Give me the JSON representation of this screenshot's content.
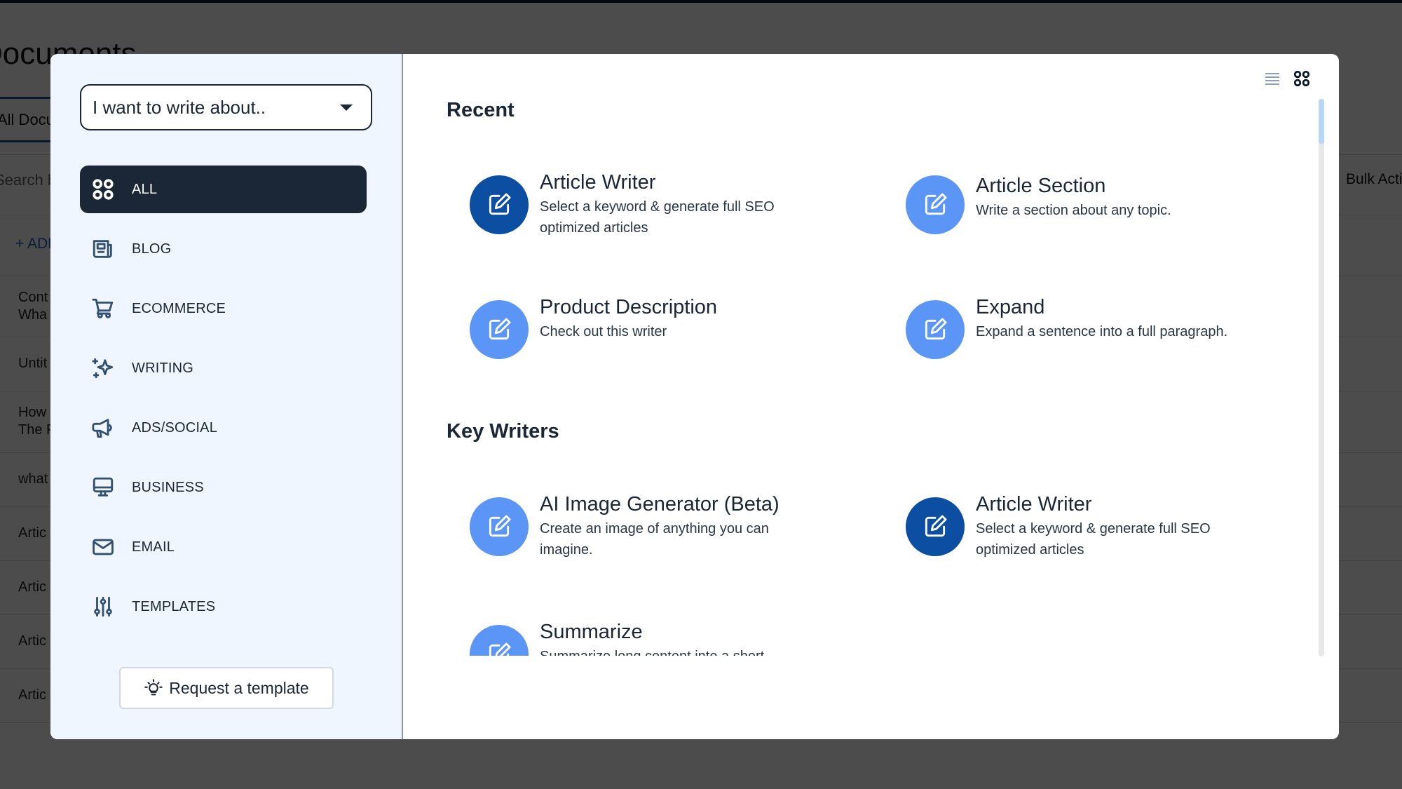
{
  "background": {
    "page_title": "Documents",
    "tab_label": "All Documents",
    "search_placeholder": "Search by",
    "bulk_actions_label": "Bulk Actions",
    "add_label": "+ ADD",
    "rows": [
      "Cont\nWha",
      "Untit",
      "How\nThe F",
      "what",
      "Artic",
      "Artic",
      "Artic",
      "Artic"
    ]
  },
  "modal": {
    "dropdown": {
      "label": "I want to write about..",
      "icon": "caret-down-icon"
    },
    "categories": [
      {
        "label": "ALL",
        "icon": "grid-icon",
        "active": true
      },
      {
        "label": "BLOG",
        "icon": "newspaper-icon",
        "active": false
      },
      {
        "label": "ECOMMERCE",
        "icon": "cart-icon",
        "active": false
      },
      {
        "label": "WRITING",
        "icon": "sparkles-icon",
        "active": false
      },
      {
        "label": "ADS/SOCIAL",
        "icon": "megaphone-icon",
        "active": false
      },
      {
        "label": "BUSINESS",
        "icon": "monitor-icon",
        "active": false
      },
      {
        "label": "EMAIL",
        "icon": "mail-icon",
        "active": false
      },
      {
        "label": "TEMPLATES",
        "icon": "sliders-icon",
        "active": false
      }
    ],
    "request_button": {
      "label": "Request a template",
      "icon": "lightbulb-icon"
    },
    "view_toggle": {
      "list_icon": "list-view-icon",
      "grid_icon": "grid-view-icon",
      "selected": "grid"
    },
    "scroll_position": 0.0,
    "sections": [
      {
        "title": "Recent",
        "cards": [
          {
            "title": "Article Writer",
            "description": "Select a keyword & generate full SEO optimized articles",
            "icon": "edit-icon",
            "color": "#0b4ea2"
          },
          {
            "title": "Article Section",
            "description": "Write a section about any topic.",
            "icon": "edit-icon",
            "color": "#5b96f7"
          },
          {
            "title": "Product Description",
            "description": "Check out this writer",
            "icon": "edit-icon",
            "color": "#5b96f7"
          },
          {
            "title": "Expand",
            "description": "Expand a sentence into a full paragraph.",
            "icon": "edit-icon",
            "color": "#5b96f7"
          }
        ]
      },
      {
        "title": "Key Writers",
        "cards": [
          {
            "title": "AI Image Generator (Beta)",
            "description": "Create an image of anything you can imagine.",
            "icon": "edit-icon",
            "color": "#5b96f7"
          },
          {
            "title": "Article Writer",
            "description": "Select a keyword & generate full SEO optimized articles",
            "icon": "edit-icon",
            "color": "#0b4ea2"
          },
          {
            "title": "Summarize",
            "description": "Summarize long content into a short",
            "icon": "edit-icon",
            "color": "#5b96f7"
          }
        ]
      }
    ]
  },
  "colors": {
    "dark_navy": "#1b2637",
    "primary_blue": "#0b4ea2",
    "light_blue": "#5b96f7",
    "sidebar_bg": "#eff6ff",
    "scroll_thumb": "#b7d6fb"
  }
}
